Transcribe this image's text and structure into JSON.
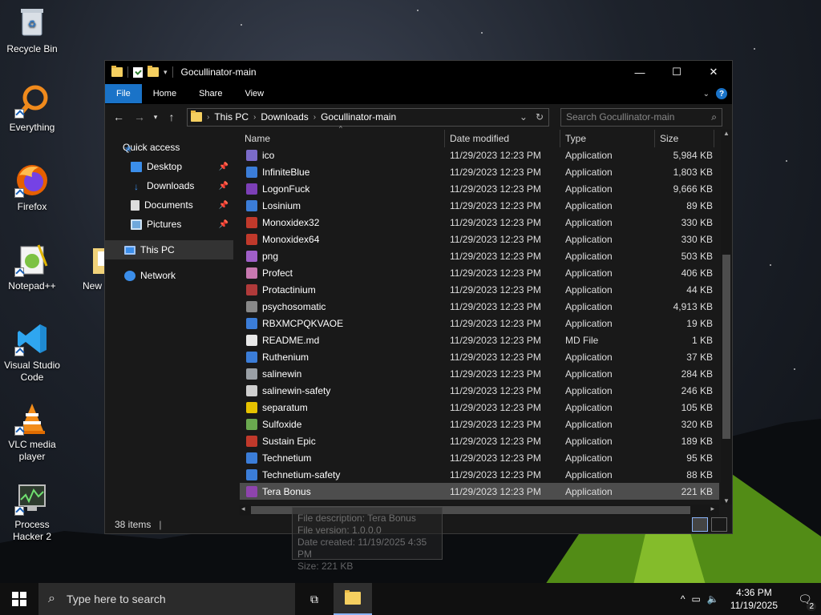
{
  "desktop": {
    "icons": [
      {
        "label": "Recycle Bin",
        "icon": "recycle-bin-icon"
      },
      {
        "label": "Everything",
        "icon": "everything-search-icon"
      },
      {
        "label": "Firefox",
        "icon": "firefox-icon"
      },
      {
        "label": "Notepad++",
        "icon": "notepad-plus-plus-icon"
      },
      {
        "label": "New fol",
        "icon": "folder-icon"
      },
      {
        "label": "Visual Studio Code",
        "icon": "vscode-icon"
      },
      {
        "label": "VLC media player",
        "icon": "vlc-icon"
      },
      {
        "label": "Process Hacker 2",
        "icon": "process-hacker-icon"
      }
    ]
  },
  "window": {
    "title": "Gocullinator-main",
    "controls": {
      "minimize": "—",
      "maximize": "☐",
      "close": "✕"
    },
    "ribbon_tabs": [
      "File",
      "Home",
      "Share",
      "View"
    ],
    "address": {
      "crumbs": [
        "This PC",
        "Downloads",
        "Gocullinator-main"
      ]
    },
    "search_placeholder": "Search Gocullinator-main",
    "nav": [
      {
        "label": "Quick access",
        "icon": "star-icon",
        "pinned": false
      },
      {
        "label": "Desktop",
        "icon": "desktop-icon",
        "pinned": true
      },
      {
        "label": "Downloads",
        "icon": "downloads-icon",
        "pinned": true
      },
      {
        "label": "Documents",
        "icon": "documents-icon",
        "pinned": true
      },
      {
        "label": "Pictures",
        "icon": "pictures-icon",
        "pinned": true
      },
      {
        "label": "This PC",
        "icon": "this-pc-icon",
        "pinned": false
      },
      {
        "label": "Network",
        "icon": "network-icon",
        "pinned": false
      }
    ],
    "columns": {
      "name": "Name",
      "date": "Date modified",
      "type": "Type",
      "size": "Size"
    },
    "files": [
      {
        "name": "ico",
        "date": "11/29/2023 12:23 PM",
        "type": "Application",
        "size": "5,984 KB",
        "color": "#7b6bc9"
      },
      {
        "name": "InfiniteBlue",
        "date": "11/29/2023 12:23 PM",
        "type": "Application",
        "size": "1,803 KB",
        "color": "#3b7dd8"
      },
      {
        "name": "LogonFuck",
        "date": "11/29/2023 12:23 PM",
        "type": "Application",
        "size": "9,666 KB",
        "color": "#7c3fb6"
      },
      {
        "name": "Losinium",
        "date": "11/29/2023 12:23 PM",
        "type": "Application",
        "size": "89 KB",
        "color": "#3b7dd8"
      },
      {
        "name": "Monoxidex32",
        "date": "11/29/2023 12:23 PM",
        "type": "Application",
        "size": "330 KB",
        "color": "#c0392b"
      },
      {
        "name": "Monoxidex64",
        "date": "11/29/2023 12:23 PM",
        "type": "Application",
        "size": "330 KB",
        "color": "#c0392b"
      },
      {
        "name": "png",
        "date": "11/29/2023 12:23 PM",
        "type": "Application",
        "size": "503 KB",
        "color": "#a05fc8"
      },
      {
        "name": "Profect",
        "date": "11/29/2023 12:23 PM",
        "type": "Application",
        "size": "406 KB",
        "color": "#c878b0"
      },
      {
        "name": "Protactinium",
        "date": "11/29/2023 12:23 PM",
        "type": "Application",
        "size": "44 KB",
        "color": "#b03a3a"
      },
      {
        "name": "psychosomatic",
        "date": "11/29/2023 12:23 PM",
        "type": "Application",
        "size": "4,913 KB",
        "color": "#888888"
      },
      {
        "name": "RBXMCPQKVAOE",
        "date": "11/29/2023 12:23 PM",
        "type": "Application",
        "size": "19 KB",
        "color": "#3b7dd8"
      },
      {
        "name": "README.md",
        "date": "11/29/2023 12:23 PM",
        "type": "MD File",
        "size": "1 KB",
        "color": "#e8e8e8"
      },
      {
        "name": "Ruthenium",
        "date": "11/29/2023 12:23 PM",
        "type": "Application",
        "size": "37 KB",
        "color": "#3b7dd8"
      },
      {
        "name": "salinewin",
        "date": "11/29/2023 12:23 PM",
        "type": "Application",
        "size": "284 KB",
        "color": "#9aa0a6"
      },
      {
        "name": "salinewin-safety",
        "date": "11/29/2023 12:23 PM",
        "type": "Application",
        "size": "246 KB",
        "color": "#cfcfcf"
      },
      {
        "name": "separatum",
        "date": "11/29/2023 12:23 PM",
        "type": "Application",
        "size": "105 KB",
        "color": "#e6c200"
      },
      {
        "name": "Sulfoxide",
        "date": "11/29/2023 12:23 PM",
        "type": "Application",
        "size": "320 KB",
        "color": "#6aa84f"
      },
      {
        "name": "Sustain Epic",
        "date": "11/29/2023 12:23 PM",
        "type": "Application",
        "size": "189 KB",
        "color": "#c0392b"
      },
      {
        "name": "Technetium",
        "date": "11/29/2023 12:23 PM",
        "type": "Application",
        "size": "95 KB",
        "color": "#3b7dd8"
      },
      {
        "name": "Technetium-safety",
        "date": "11/29/2023 12:23 PM",
        "type": "Application",
        "size": "88 KB",
        "color": "#3b7dd8"
      },
      {
        "name": "Tera Bonus",
        "date": "11/29/2023 12:23 PM",
        "type": "Application",
        "size": "221 KB",
        "color": "#8e44ad",
        "selected": true
      }
    ],
    "status": {
      "items": "38 items"
    },
    "tooltip": {
      "line1": "File description: Tera Bonus",
      "line2": "File version: 1.0.0.0",
      "line3": "Date created: 11/19/2025 4:35 PM",
      "line4": "Size: 221 KB"
    }
  },
  "taskbar": {
    "search_placeholder": "Type here to search",
    "time": "4:36 PM",
    "date": "11/19/2025",
    "notifications": "2",
    "accent": "#8ab4f8"
  }
}
